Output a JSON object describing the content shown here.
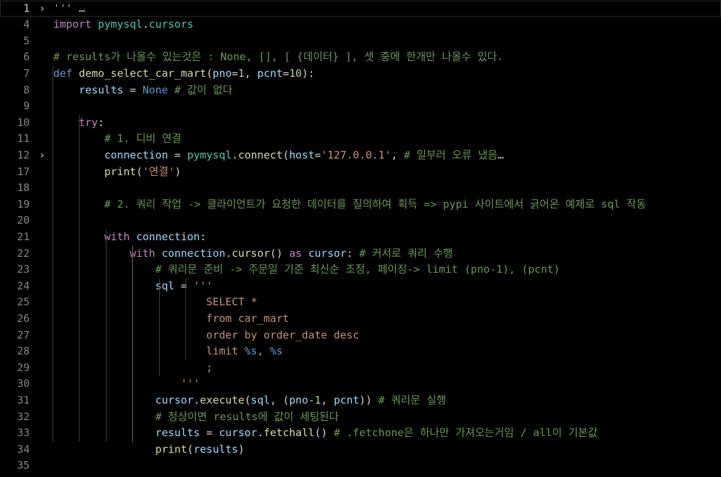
{
  "editor": {
    "lines": [
      {
        "n": "1",
        "fold": "›",
        "current": true,
        "tokens": [
          [
            "'''",
            "str"
          ],
          [
            " …",
            "ell"
          ]
        ]
      },
      {
        "n": "4",
        "tokens": [
          [
            "import",
            "ctrl"
          ],
          [
            " ",
            "def"
          ],
          [
            "pymysql",
            "cls"
          ],
          [
            ".",
            "def"
          ],
          [
            "cursors",
            "cls"
          ]
        ]
      },
      {
        "n": "5",
        "tokens": []
      },
      {
        "n": "6",
        "tokens": [
          [
            "# results가 나올수 있는것은 : None, [], [ {데이터} ], 셋 중에 한개만 나올수 있다.",
            "com"
          ]
        ]
      },
      {
        "n": "7",
        "tokens": [
          [
            "def",
            "kw"
          ],
          [
            " ",
            "def"
          ],
          [
            "demo_select_car_mart",
            "fn"
          ],
          [
            "(",
            "def"
          ],
          [
            "pno",
            "var"
          ],
          [
            "=",
            "def"
          ],
          [
            "1",
            "num"
          ],
          [
            ", ",
            "def"
          ],
          [
            "pcnt",
            "var"
          ],
          [
            "=",
            "def"
          ],
          [
            "10",
            "num"
          ],
          [
            "):",
            "def"
          ]
        ]
      },
      {
        "n": "8",
        "tokens": [
          [
            "    ",
            "def"
          ],
          [
            "results",
            "var"
          ],
          [
            " = ",
            "def"
          ],
          [
            "None",
            "kw"
          ],
          [
            " ",
            "def"
          ],
          [
            "# 값이 없다",
            "com"
          ]
        ]
      },
      {
        "n": "9",
        "tokens": []
      },
      {
        "n": "10",
        "tokens": [
          [
            "    ",
            "def"
          ],
          [
            "try",
            "ctrl"
          ],
          [
            ":",
            "def"
          ]
        ]
      },
      {
        "n": "11",
        "tokens": [
          [
            "        ",
            "def"
          ],
          [
            "# 1. 디비 연결",
            "com"
          ]
        ]
      },
      {
        "n": "12",
        "fold": "›",
        "tokens": [
          [
            "        ",
            "def"
          ],
          [
            "connection",
            "var"
          ],
          [
            " = ",
            "def"
          ],
          [
            "pymysql",
            "cls"
          ],
          [
            ".",
            "def"
          ],
          [
            "connect",
            "fn"
          ],
          [
            "(",
            "def"
          ],
          [
            "host",
            "var"
          ],
          [
            "=",
            "def"
          ],
          [
            "'127.0.0.1'",
            "str"
          ],
          [
            ", ",
            "def"
          ],
          [
            "# 일부러 오류 냈음",
            "com"
          ],
          [
            "…",
            "ell"
          ]
        ]
      },
      {
        "n": "17",
        "tokens": [
          [
            "        ",
            "def"
          ],
          [
            "print",
            "fn"
          ],
          [
            "(",
            "def"
          ],
          [
            "'연결'",
            "str"
          ],
          [
            ")",
            "def"
          ]
        ]
      },
      {
        "n": "18",
        "tokens": []
      },
      {
        "n": "19",
        "tokens": [
          [
            "        ",
            "def"
          ],
          [
            "# 2. 쿼리 작업 -> 클라이언트가 요청한 데이터를 질의하여 획득 => pypi 사이트에서 긁어온 예제로 sql 작동",
            "com"
          ]
        ]
      },
      {
        "n": "20",
        "tokens": []
      },
      {
        "n": "21",
        "tokens": [
          [
            "        ",
            "def"
          ],
          [
            "with",
            "ctrl"
          ],
          [
            " ",
            "def"
          ],
          [
            "connection",
            "var"
          ],
          [
            ":",
            "def"
          ]
        ]
      },
      {
        "n": "22",
        "tokens": [
          [
            "            ",
            "def"
          ],
          [
            "with",
            "ctrl"
          ],
          [
            " ",
            "def"
          ],
          [
            "connection",
            "var"
          ],
          [
            ".",
            "def"
          ],
          [
            "cursor",
            "fn"
          ],
          [
            "() ",
            "def"
          ],
          [
            "as",
            "ctrl"
          ],
          [
            " ",
            "def"
          ],
          [
            "cursor",
            "var"
          ],
          [
            ": ",
            "def"
          ],
          [
            "# 커서로 쿼리 수행",
            "com"
          ]
        ]
      },
      {
        "n": "23",
        "tokens": [
          [
            "                ",
            "def"
          ],
          [
            "# 쿼리문 준비 -> 주문일 기준 최신순 조정, 페이징-> limit (pno-1), (pcnt)",
            "com"
          ]
        ]
      },
      {
        "n": "24",
        "tokens": [
          [
            "                ",
            "def"
          ],
          [
            "sql",
            "var"
          ],
          [
            " = ",
            "def"
          ],
          [
            "'''",
            "str"
          ]
        ]
      },
      {
        "n": "25",
        "tokens": [
          [
            "                        ",
            "def"
          ],
          [
            "SELECT *",
            "str"
          ]
        ]
      },
      {
        "n": "26",
        "tokens": [
          [
            "                        ",
            "def"
          ],
          [
            "from car_mart",
            "str"
          ]
        ]
      },
      {
        "n": "27",
        "tokens": [
          [
            "                        ",
            "def"
          ],
          [
            "order by order_date desc",
            "str"
          ]
        ]
      },
      {
        "n": "28",
        "tokens": [
          [
            "                        ",
            "def"
          ],
          [
            "limit ",
            "str"
          ],
          [
            "%s",
            "fmt"
          ],
          [
            ", ",
            "str"
          ],
          [
            "%s",
            "fmt"
          ]
        ]
      },
      {
        "n": "29",
        "tokens": [
          [
            "                        ",
            "def"
          ],
          [
            ";",
            "str"
          ]
        ]
      },
      {
        "n": "30",
        "tokens": [
          [
            "                    ",
            "def"
          ],
          [
            "'''",
            "str"
          ]
        ]
      },
      {
        "n": "31",
        "tokens": [
          [
            "                ",
            "def"
          ],
          [
            "cursor",
            "var"
          ],
          [
            ".",
            "def"
          ],
          [
            "execute",
            "fn"
          ],
          [
            "(",
            "def"
          ],
          [
            "sql",
            "var"
          ],
          [
            ", (",
            "def"
          ],
          [
            "pno",
            "var"
          ],
          [
            "-",
            "def"
          ],
          [
            "1",
            "num"
          ],
          [
            ", ",
            "def"
          ],
          [
            "pcnt",
            "var"
          ],
          [
            ")) ",
            "def"
          ],
          [
            "# 쿼리문 실행",
            "com"
          ]
        ]
      },
      {
        "n": "32",
        "tokens": [
          [
            "                ",
            "def"
          ],
          [
            "# 정상이면 results에 값이 세팅된다",
            "com"
          ]
        ]
      },
      {
        "n": "33",
        "tokens": [
          [
            "                ",
            "def"
          ],
          [
            "results",
            "var"
          ],
          [
            " = ",
            "def"
          ],
          [
            "cursor",
            "var"
          ],
          [
            ".",
            "def"
          ],
          [
            "fetchall",
            "fn"
          ],
          [
            "() ",
            "def"
          ],
          [
            "# .fetchone은 하나만 가져오는거임 / all이 기본값",
            "com"
          ]
        ]
      },
      {
        "n": "34",
        "tokens": [
          [
            "                ",
            "def"
          ],
          [
            "print",
            "fn"
          ],
          [
            "(",
            "def"
          ],
          [
            "results",
            "var"
          ],
          [
            ")",
            "def"
          ]
        ]
      },
      {
        "n": "35",
        "tokens": []
      }
    ]
  }
}
